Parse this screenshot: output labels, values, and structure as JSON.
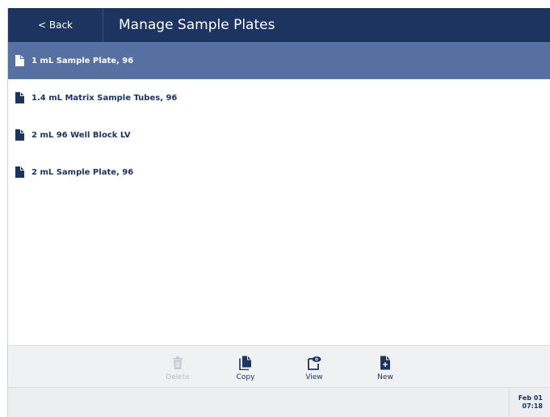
{
  "header": {
    "back_label": "< Back",
    "title": "Manage Sample Plates"
  },
  "plates": [
    {
      "label": "1 mL Sample Plate, 96",
      "selected": true
    },
    {
      "label": "1.4 mL Matrix Sample Tubes, 96",
      "selected": false
    },
    {
      "label": "2 mL 96 Well Block LV",
      "selected": false
    },
    {
      "label": "2 mL Sample Plate, 96",
      "selected": false
    }
  ],
  "toolbar": {
    "delete_label": "Delete",
    "delete_enabled": false,
    "copy_label": "Copy",
    "view_label": "View",
    "new_label": "New"
  },
  "status": {
    "date": "Feb 01",
    "time": "07:18"
  },
  "colors": {
    "header": "#1d3461",
    "selected_row": "#5670a1",
    "icon": "#1d3461",
    "disabled": "#b7bcc6"
  },
  "icons": {
    "document": "document-icon",
    "trash": "trash-icon",
    "copy": "copy-icon",
    "view": "view-icon",
    "new": "new-document-icon"
  }
}
